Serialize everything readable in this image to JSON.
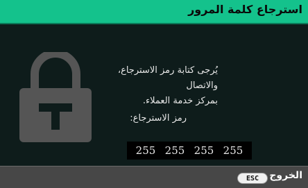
{
  "dialog": {
    "title": "استرجاع كلمة المرور",
    "lock_icon": "lock-icon",
    "message_lines": [
      "يُرجى كتابة رمز الاسترجاع،",
      "والاتصال",
      "بمركز خدمة العملاء."
    ],
    "code_label": "رمز الاسترجاع:",
    "code_groups": [
      "255",
      "255",
      "255",
      "255"
    ]
  },
  "footer": {
    "exit_label": "الخروج",
    "esc_key_label": "ESC"
  },
  "colors": {
    "title_bar": "#14c28c",
    "background": "#0e1c1b",
    "footer": "#474747",
    "lock_icon": "#555555"
  }
}
